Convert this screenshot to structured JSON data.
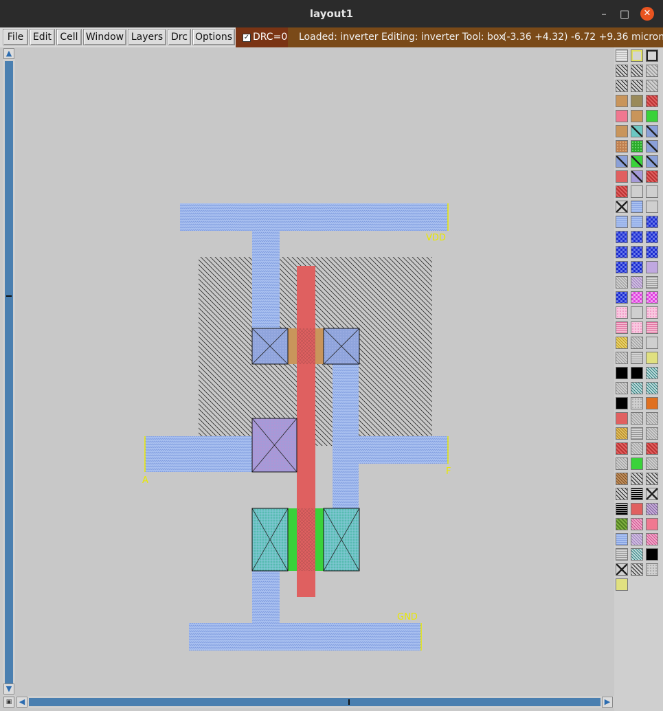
{
  "window": {
    "title": "layout1"
  },
  "menu": {
    "items": [
      "File",
      "Edit",
      "Cell",
      "Window",
      "Layers",
      "Drc",
      "Options"
    ],
    "drc_label": "DRC=0"
  },
  "status": {
    "text": "Loaded: inverter Editing: inverter Tool: box",
    "coords": "(-3.36 +4.32) -6.72 +9.36 microns"
  },
  "labels": {
    "vdd": "VDD",
    "gnd": "GND",
    "input": "A",
    "output": "F"
  },
  "colors": {
    "metal1": "#9fb7ec",
    "poly": "#df5f5f",
    "ndiff": "#3ad23a",
    "pdiff": "#c9955b",
    "contact": "#8aa0d8",
    "label": "#e8e800"
  },
  "palette": {
    "swatches": [
      "grid",
      "outline-yellow",
      "outline-black",
      "hatch-dark",
      "hatch-dark",
      "hatch-gray",
      "hatch-dark",
      "hatch-dark",
      "hatch-gray",
      "tan",
      "olive",
      "red-hatch",
      "pink",
      "tan",
      "green",
      "tan",
      "cyan-x",
      "blue-x",
      "tan-dots",
      "green-dots",
      "blue-x",
      "blue-x",
      "green-x",
      "blue-x",
      "red",
      "purple-x",
      "red-hatch",
      "red-hatch",
      "gray",
      "gray",
      "black-x",
      "blue-stripe",
      "gray",
      "blue-stripe",
      "blue-stripe",
      "blue-check",
      "blue-check",
      "blue-check",
      "blue-check",
      "blue-check",
      "blue-check",
      "blue-check",
      "blue-check",
      "blue-check",
      "violet",
      "gray-hatch",
      "violet-hatch",
      "gray-stripe",
      "blue-check",
      "magenta",
      "magenta",
      "pink-dots",
      "gray",
      "pink-dots",
      "pink-stripe",
      "pink-dots",
      "pink-stripe",
      "yellow-pattern",
      "gray-hatch",
      "gray",
      "gray-hatch",
      "gray-stripe",
      "yellow-light",
      "black",
      "black",
      "teal-hatch",
      "gray-hatch",
      "teal-hatch",
      "teal-hatch",
      "black",
      "dotted",
      "orange",
      "red",
      "gray-hatch",
      "gray-hatch",
      "gold-hatch",
      "gray-stripe",
      "gray-hatch",
      "red-hatch",
      "gray-hatch",
      "red-hatch",
      "gray-hatch",
      "green",
      "gray-hatch",
      "brown-hatch",
      "hatch-dark",
      "hatch-dark",
      "hatch-dark",
      "black-lines",
      "black-x",
      "black-lines",
      "red",
      "purple-hatch",
      "olive-green",
      "pink-hatch",
      "pink",
      "blue-stripe",
      "violet-hatch",
      "pink-hatch",
      "gray-stripe",
      "teal-hatch",
      "black",
      "black-x",
      "hatch-dark",
      "dotted",
      "yellow-light"
    ]
  }
}
